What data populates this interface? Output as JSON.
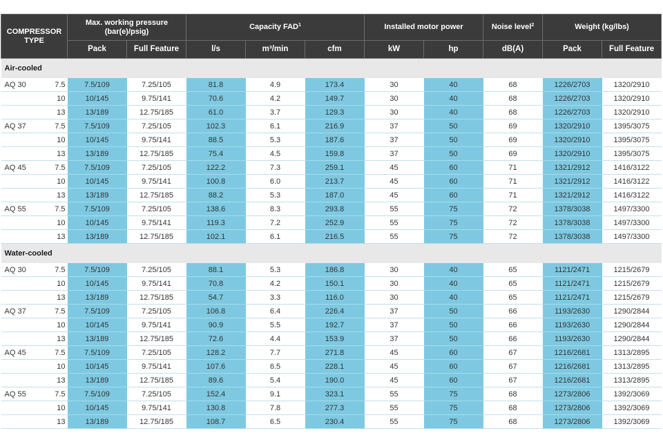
{
  "header": {
    "compressor_type": "COMPRESSOR TYPE",
    "pressure_group": "Max. working pressure (bar(e)/psig)",
    "capacity_group": "Capacity FAD",
    "capacity_sup": "1",
    "motor_group": "Installed motor power",
    "noise_group": "Noise level",
    "noise_sup": "2",
    "weight_group": "Weight (kg/lbs)",
    "sub": [
      "Pack",
      "Full Feature",
      "l/s",
      "m³/min",
      "cfm",
      "kW",
      "hp",
      "dB(A)",
      "Pack",
      "Full Feature"
    ]
  },
  "sections": [
    {
      "title": "Air-cooled",
      "rows": [
        {
          "model": "AQ 30",
          "bar": "7.5",
          "p_pack": "7.5/109",
          "p_ff": "7.25/105",
          "ls": "81.8",
          "m3": "4.9",
          "cfm": "173.4",
          "kw": "30",
          "hp": "40",
          "db": "68",
          "w_pack": "1226/2703",
          "w_ff": "1320/2910"
        },
        {
          "model": "",
          "bar": "10",
          "p_pack": "10/145",
          "p_ff": "9.75/141",
          "ls": "70.6",
          "m3": "4.2",
          "cfm": "149.7",
          "kw": "30",
          "hp": "40",
          "db": "68",
          "w_pack": "1226/2703",
          "w_ff": "1320/2910"
        },
        {
          "model": "",
          "bar": "13",
          "p_pack": "13/189",
          "p_ff": "12.75/185",
          "ls": "61.0",
          "m3": "3.7",
          "cfm": "129.3",
          "kw": "30",
          "hp": "40",
          "db": "68",
          "w_pack": "1226/2703",
          "w_ff": "1320/2910"
        },
        {
          "model": "AQ 37",
          "bar": "7.5",
          "p_pack": "7.5/109",
          "p_ff": "7.25/105",
          "ls": "102.3",
          "m3": "6.1",
          "cfm": "216.9",
          "kw": "37",
          "hp": "50",
          "db": "69",
          "w_pack": "1320/2910",
          "w_ff": "1395/3075"
        },
        {
          "model": "",
          "bar": "10",
          "p_pack": "10/145",
          "p_ff": "9.75/141",
          "ls": "88.5",
          "m3": "5.3",
          "cfm": "187.6",
          "kw": "37",
          "hp": "50",
          "db": "69",
          "w_pack": "1320/2910",
          "w_ff": "1395/3075"
        },
        {
          "model": "",
          "bar": "13",
          "p_pack": "13/189",
          "p_ff": "12.75/185",
          "ls": "75.4",
          "m3": "4.5",
          "cfm": "159.8",
          "kw": "37",
          "hp": "50",
          "db": "69",
          "w_pack": "1320/2910",
          "w_ff": "1395/3075"
        },
        {
          "model": "AQ 45",
          "bar": "7.5",
          "p_pack": "7.5/109",
          "p_ff": "7.25/105",
          "ls": "122.2",
          "m3": "7.3",
          "cfm": "259.1",
          "kw": "45",
          "hp": "60",
          "db": "71",
          "w_pack": "1321/2912",
          "w_ff": "1416/3122"
        },
        {
          "model": "",
          "bar": "10",
          "p_pack": "10/145",
          "p_ff": "9.75/141",
          "ls": "100.8",
          "m3": "6.0",
          "cfm": "213.7",
          "kw": "45",
          "hp": "60",
          "db": "71",
          "w_pack": "1321/2912",
          "w_ff": "1416/3122"
        },
        {
          "model": "",
          "bar": "13",
          "p_pack": "13/189",
          "p_ff": "12.75/185",
          "ls": "88.2",
          "m3": "5.3",
          "cfm": "187.0",
          "kw": "45",
          "hp": "60",
          "db": "71",
          "w_pack": "1321/2912",
          "w_ff": "1416/3122"
        },
        {
          "model": "AQ 55",
          "bar": "7.5",
          "p_pack": "7.5/109",
          "p_ff": "7.25/105",
          "ls": "138.6",
          "m3": "8.3",
          "cfm": "293.8",
          "kw": "55",
          "hp": "75",
          "db": "72",
          "w_pack": "1378/3038",
          "w_ff": "1497/3300"
        },
        {
          "model": "",
          "bar": "10",
          "p_pack": "10/145",
          "p_ff": "9.75/141",
          "ls": "119.3",
          "m3": "7.2",
          "cfm": "252.9",
          "kw": "55",
          "hp": "75",
          "db": "72",
          "w_pack": "1378/3038",
          "w_ff": "1497/3300"
        },
        {
          "model": "",
          "bar": "13",
          "p_pack": "13/189",
          "p_ff": "12.75/185",
          "ls": "102.1",
          "m3": "6.1",
          "cfm": "216.5",
          "kw": "55",
          "hp": "75",
          "db": "72",
          "w_pack": "1378/3038",
          "w_ff": "1497/3300"
        }
      ]
    },
    {
      "title": "Water-cooled",
      "rows": [
        {
          "model": "AQ 30",
          "bar": "7.5",
          "p_pack": "7.5/109",
          "p_ff": "7.25/105",
          "ls": "88.1",
          "m3": "5.3",
          "cfm": "186.8",
          "kw": "30",
          "hp": "40",
          "db": "65",
          "w_pack": "1121/2471",
          "w_ff": "1215/2679"
        },
        {
          "model": "",
          "bar": "10",
          "p_pack": "10/145",
          "p_ff": "9.75/141",
          "ls": "70.8",
          "m3": "4.2",
          "cfm": "150.1",
          "kw": "30",
          "hp": "40",
          "db": "65",
          "w_pack": "1121/2471",
          "w_ff": "1215/2679"
        },
        {
          "model": "",
          "bar": "13",
          "p_pack": "13/189",
          "p_ff": "12.75/185",
          "ls": "54.7",
          "m3": "3.3",
          "cfm": "116.0",
          "kw": "30",
          "hp": "40",
          "db": "65",
          "w_pack": "1121/2471",
          "w_ff": "1215/2679"
        },
        {
          "model": "AQ 37",
          "bar": "7.5",
          "p_pack": "7.5/109",
          "p_ff": "7.25/105",
          "ls": "106.8",
          "m3": "6.4",
          "cfm": "226.4",
          "kw": "37",
          "hp": "50",
          "db": "66",
          "w_pack": "1193/2630",
          "w_ff": "1290/2844"
        },
        {
          "model": "",
          "bar": "10",
          "p_pack": "10/145",
          "p_ff": "9.75/141",
          "ls": "90.9",
          "m3": "5.5",
          "cfm": "192.7",
          "kw": "37",
          "hp": "50",
          "db": "66",
          "w_pack": "1193/2630",
          "w_ff": "1290/2844"
        },
        {
          "model": "",
          "bar": "13",
          "p_pack": "13/189",
          "p_ff": "12.75/185",
          "ls": "72.6",
          "m3": "4.4",
          "cfm": "153.9",
          "kw": "37",
          "hp": "50",
          "db": "66",
          "w_pack": "1193/2630",
          "w_ff": "1290/2844"
        },
        {
          "model": "AQ 45",
          "bar": "7.5",
          "p_pack": "7.5/109",
          "p_ff": "7.25/105",
          "ls": "128.2",
          "m3": "7.7",
          "cfm": "271.8",
          "kw": "45",
          "hp": "60",
          "db": "67",
          "w_pack": "1216/2681",
          "w_ff": "1313/2895"
        },
        {
          "model": "",
          "bar": "10",
          "p_pack": "10/145",
          "p_ff": "9.75/141",
          "ls": "107.6",
          "m3": "6.5",
          "cfm": "228.1",
          "kw": "45",
          "hp": "60",
          "db": "67",
          "w_pack": "1216/2681",
          "w_ff": "1313/2895"
        },
        {
          "model": "",
          "bar": "13",
          "p_pack": "13/189",
          "p_ff": "12.75/185",
          "ls": "89.6",
          "m3": "5.4",
          "cfm": "190.0",
          "kw": "45",
          "hp": "60",
          "db": "67",
          "w_pack": "1216/2681",
          "w_ff": "1313/2895"
        },
        {
          "model": "AQ 55",
          "bar": "7.5",
          "p_pack": "7.5/109",
          "p_ff": "7.25/105",
          "ls": "152.4",
          "m3": "9.1",
          "cfm": "323.1",
          "kw": "55",
          "hp": "75",
          "db": "68",
          "w_pack": "1273/2806",
          "w_ff": "1392/3069"
        },
        {
          "model": "",
          "bar": "10",
          "p_pack": "10/145",
          "p_ff": "9.75/141",
          "ls": "130.8",
          "m3": "7.8",
          "cfm": "277.3",
          "kw": "55",
          "hp": "75",
          "db": "68",
          "w_pack": "1273/2806",
          "w_ff": "1392/3069"
        },
        {
          "model": "",
          "bar": "13",
          "p_pack": "13/189",
          "p_ff": "12.75/185",
          "ls": "108.7",
          "m3": "6.5",
          "cfm": "230.4",
          "kw": "55",
          "hp": "75",
          "db": "68",
          "w_pack": "1273/2806",
          "w_ff": "1392/3069"
        }
      ]
    }
  ]
}
